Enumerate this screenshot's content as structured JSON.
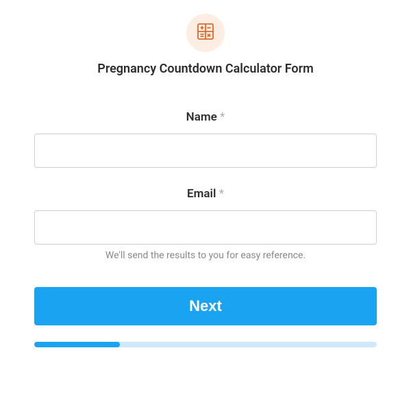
{
  "header": {
    "icon": "calculator-icon",
    "title": "Pregnancy Countdown Calculator Form"
  },
  "fields": {
    "name": {
      "label": "Name",
      "required": true,
      "value": ""
    },
    "email": {
      "label": "Email",
      "required": true,
      "value": "",
      "help": "We'll send the results to you for easy reference."
    }
  },
  "button": {
    "next_label": "Next"
  },
  "progress": {
    "percent": 25
  },
  "colors": {
    "accent": "#1aa3f0",
    "icon_bg": "#fdede3",
    "icon_color": "#d96b2b"
  }
}
